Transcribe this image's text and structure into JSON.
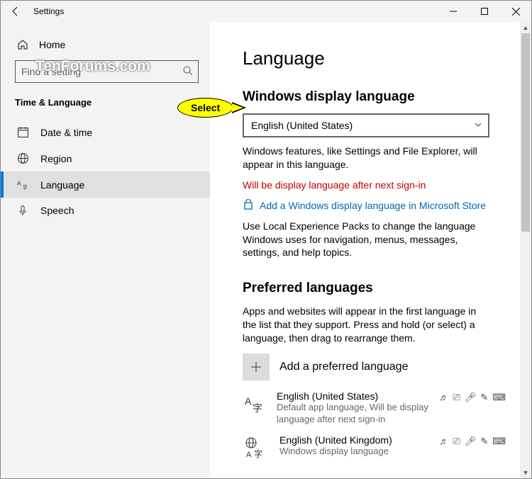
{
  "titlebar": {
    "title": "Settings"
  },
  "sidebar": {
    "home": "Home",
    "search_placeholder": "Find a setting",
    "section": "Time & Language",
    "items": [
      {
        "icon": "clock",
        "label": "Date & time"
      },
      {
        "icon": "globe",
        "label": "Region"
      },
      {
        "icon": "az",
        "label": "Language",
        "active": true
      },
      {
        "icon": "mic",
        "label": "Speech"
      }
    ]
  },
  "main": {
    "heading": "Language",
    "display_section": {
      "title": "Windows display language",
      "selected": "English (United States)",
      "desc": "Windows features, like Settings and File Explorer, will appear in this language.",
      "warning": "Will be display language after next sign-in",
      "store_link": "Add a Windows display language in Microsoft Store",
      "packs_desc": "Use Local Experience Packs to change the language Windows uses for navigation, menus, messages, settings, and help topics."
    },
    "preferred_section": {
      "title": "Preferred languages",
      "desc": "Apps and websites will appear in the first language in the list that they support. Press and hold (or select) a language, then drag to rearrange them.",
      "add_label": "Add a preferred language",
      "langs": [
        {
          "name": "English (United States)",
          "sub": "Default app language, Will be display language after next sign-in"
        },
        {
          "name": "English (United Kingdom)",
          "sub": "Windows display language"
        }
      ]
    }
  },
  "callout": {
    "label": "Select"
  },
  "watermark": "TenForums.com"
}
